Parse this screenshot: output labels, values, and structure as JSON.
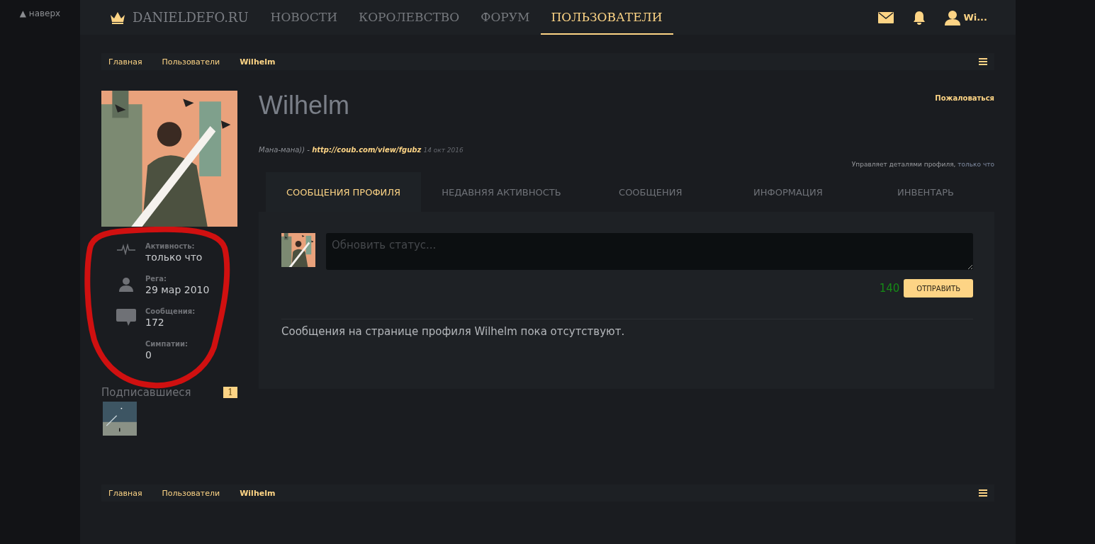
{
  "back_to_top": "▲ наверх",
  "nav": {
    "brand": "DANIELDEFO.RU",
    "items": [
      {
        "label": "НОВОСТИ",
        "selected": false
      },
      {
        "label": "КОРОЛЕВСТВО",
        "selected": false
      },
      {
        "label": "ФОРУМ",
        "selected": false
      },
      {
        "label": "ПОЛЬЗОВАТЕЛИ",
        "selected": true
      }
    ],
    "user": "Wi..."
  },
  "breadcrumb_top": [
    {
      "label": "Главная",
      "current": false
    },
    {
      "label": "Пользователи",
      "current": false
    },
    {
      "label": "Wilhelm",
      "current": true
    }
  ],
  "sidebar": {
    "stats": [
      {
        "kind": "activity",
        "label": "Активность:",
        "value": "только что"
      },
      {
        "kind": "person",
        "label": "Рега:",
        "value": "29 мар 2010"
      },
      {
        "kind": "messages",
        "label": "Сообщения:",
        "value": "172"
      },
      {
        "kind": "none",
        "label": "Симпатии:",
        "value": "0"
      }
    ],
    "followers": {
      "title": "Подписавшиеся",
      "count": "1"
    }
  },
  "profile": {
    "name": "Wilhelm",
    "report": "Пожаловаться",
    "status": {
      "text": "Мана-мана)) - ",
      "link": "http://coub.com/view/fgubz",
      "date": "14 окт 2016"
    },
    "managed": {
      "text": "Управляет деталями профиля,",
      "time": "только что"
    }
  },
  "tabs": [
    {
      "label": "СООБЩЕНИЯ ПРОФИЛЯ",
      "selected": true
    },
    {
      "label": "НЕДАВНЯЯ АКТИВНОСТЬ",
      "selected": false
    },
    {
      "label": "СООБЩЕНИЯ",
      "selected": false
    },
    {
      "label": "ИНФОРМАЦИЯ",
      "selected": false
    },
    {
      "label": "ИНВЕНТАРЬ",
      "selected": false
    }
  ],
  "composer": {
    "placeholder": "Обновить статус...",
    "counter": "140",
    "button": "ОТПРАВИТЬ"
  },
  "empty_message": "Сообщения на странице профиля Wilhelm пока отсутствуют.",
  "breadcrumb_bottom": [
    {
      "label": "Главная",
      "current": false
    },
    {
      "label": "Пользователи",
      "current": false
    },
    {
      "label": "Wilhelm",
      "current": true
    }
  ],
  "annotation": {
    "kind": "red-circle"
  }
}
